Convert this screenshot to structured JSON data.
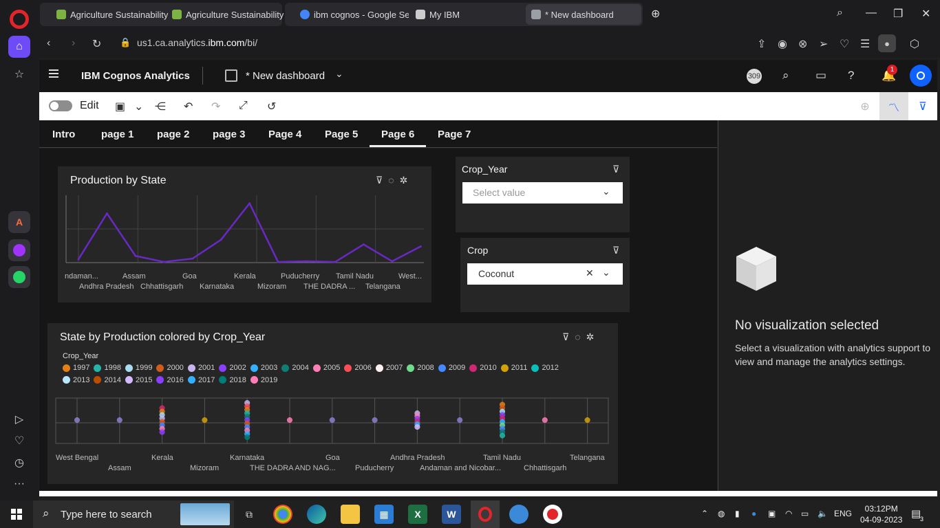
{
  "browser": {
    "tabs": [
      {
        "label": "Agriculture Sustainability",
        "color": "#7cb342"
      },
      {
        "label": "Agriculture Sustainability",
        "color": "#7cb342"
      },
      {
        "label": "ibm cognos - Google Sear",
        "color": "#4285f4"
      },
      {
        "label": "My IBM",
        "color": "#cccccc"
      },
      {
        "label": "* New dashboard",
        "color": "#9aa0a6"
      }
    ],
    "url_prefix": "us1.ca.analytics.",
    "url_domain": "ibm.com",
    "url_suffix": "/bi/"
  },
  "app": {
    "brand": "IBM Cognos Analytics",
    "dashboard_title": "* New dashboard",
    "count_badge": "309",
    "notification_count": "1"
  },
  "toolbar": {
    "edit_label": "Edit"
  },
  "page_tabs": [
    "Intro",
    "page 1",
    "page 2",
    "page 3",
    "Page 4",
    "Page 5",
    "Page 6",
    "Page 7"
  ],
  "active_tab": "Page 6",
  "production_chart": {
    "title": "Production by State",
    "top_ticks": [
      "ndaman...",
      "Assam",
      "Goa",
      "Kerala",
      "Puducherry",
      "Tamil Nadu",
      "West..."
    ],
    "bottom_ticks": [
      "Andhra Pradesh",
      "Chhattisgarh",
      "Karnataka",
      "Mizoram",
      "THE DADRA ...",
      "Telangana"
    ]
  },
  "filters": {
    "crop_year": {
      "title": "Crop_Year",
      "placeholder": "Select value"
    },
    "crop": {
      "title": "Crop",
      "value": "Coconut"
    }
  },
  "scatter_chart": {
    "title": "State by Production colored by Crop_Year",
    "legend_title": "Crop_Year",
    "top_ticks": [
      "West Bengal",
      "Kerala",
      "Karnataka",
      "Goa",
      "Andhra Pradesh",
      "Tamil Nadu",
      "Telangana"
    ],
    "bottom_ticks": [
      "Assam",
      "Mizoram",
      "THE DADRA AND NAG...",
      "Puducherry",
      "Andaman and Nicobar...",
      "Chhattisgarh"
    ]
  },
  "chart_data": [
    {
      "type": "line",
      "title": "Production by State",
      "categories": [
        "Andaman and Nicobar",
        "Andhra Pradesh",
        "Assam",
        "Chhattisgarh",
        "Goa",
        "Karnataka",
        "Kerala",
        "Mizoram",
        "Puducherry",
        "THE DADRA AND NAGAR HAVELI",
        "Tamil Nadu",
        "Telangana",
        "West Bengal"
      ],
      "values": [
        0.05,
        0.73,
        0.1,
        0.01,
        0.06,
        0.34,
        0.88,
        0.01,
        0.02,
        0.01,
        0.27,
        0.02,
        0.24
      ],
      "color": "#6929c4",
      "grid": true
    },
    {
      "type": "scatter",
      "title": "State by Production colored by Crop_Year",
      "legend_title": "Crop_Year",
      "legend": [
        {
          "label": "1997",
          "color": "#e37f16"
        },
        {
          "label": "1998",
          "color": "#24b5a8"
        },
        {
          "label": "1999",
          "color": "#a8dcf2"
        },
        {
          "label": "2000",
          "color": "#d15b1b"
        },
        {
          "label": "2001",
          "color": "#c8b4ef"
        },
        {
          "label": "2002",
          "color": "#8a3ffc"
        },
        {
          "label": "2003",
          "color": "#33b1ff"
        },
        {
          "label": "2004",
          "color": "#117e75"
        },
        {
          "label": "2005",
          "color": "#ff7eb6"
        },
        {
          "label": "2006",
          "color": "#fa4d56"
        },
        {
          "label": "2007",
          "color": "#fff1f1"
        },
        {
          "label": "2008",
          "color": "#6fdc8c"
        },
        {
          "label": "2009",
          "color": "#4589ff"
        },
        {
          "label": "2010",
          "color": "#d12771"
        },
        {
          "label": "2011",
          "color": "#d2a106"
        },
        {
          "label": "2012",
          "color": "#08bdba"
        },
        {
          "label": "2013",
          "color": "#bae6ff"
        },
        {
          "label": "2014",
          "color": "#ba4e00"
        },
        {
          "label": "2015",
          "color": "#d4bbff"
        },
        {
          "label": "2016",
          "color": "#8a3ffc"
        },
        {
          "label": "2017",
          "color": "#33b1ff"
        },
        {
          "label": "2018",
          "color": "#007d79"
        },
        {
          "label": "2019",
          "color": "#ff7eb6"
        }
      ],
      "categories": [
        "West Bengal",
        "Assam",
        "Kerala",
        "Mizoram",
        "Karnataka",
        "THE DADRA AND NAGAR HAVELI",
        "Goa",
        "Puducherry",
        "Andhra Pradesh",
        "Andaman and Nicobar",
        "Tamil Nadu",
        "Chhattisgarh",
        "Telangana"
      ],
      "point_colors": [
        [
          "#8e7ecf"
        ],
        [
          "#8e7ecf"
        ],
        [
          "#d12771",
          "#e37f16",
          "#a8dcf2",
          "#c8b4ef",
          "#d15b1b",
          "#4589ff",
          "#ff7eb6",
          "#8a3ffc"
        ],
        [
          "#d2a106"
        ],
        [
          "#c8b4ef",
          "#fa4d56",
          "#e37f16",
          "#24b5a8",
          "#117e75",
          "#8a3ffc",
          "#d15b1b",
          "#4589ff",
          "#ff7eb6",
          "#33b1ff",
          "#007d79"
        ],
        [
          "#ff7eb6"
        ],
        [
          "#8e7ecf"
        ],
        [
          "#8e7ecf"
        ],
        [
          "#c8b4ef",
          "#ff7eb6",
          "#8a3ffc",
          "#d12771",
          "#33b1ff",
          "#d4bbff"
        ],
        [
          "#8e7ecf"
        ],
        [
          "#e37f16",
          "#d15b1b",
          "#a8dcf2",
          "#8a3ffc",
          "#d12771",
          "#33b1ff",
          "#6fdc8c",
          "#4589ff",
          "#117e75",
          "#24b5a8"
        ],
        [
          "#ff7eb6"
        ],
        [
          "#d2a106"
        ]
      ],
      "grid": true
    }
  ],
  "analytics_pane": {
    "title": "No visualization selected",
    "description": "Select a visualization with analytics support to view and manage the analytics settings."
  },
  "taskbar": {
    "search_placeholder": "Type here to search",
    "language": "ENG",
    "time": "03:12PM",
    "date": "04-09-2023",
    "notification_count": "3"
  }
}
